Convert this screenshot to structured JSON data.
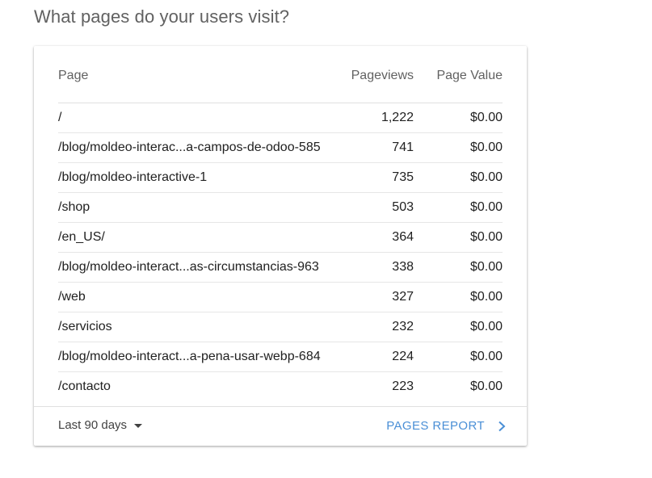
{
  "heading": "What pages do your users visit?",
  "table": {
    "headers": {
      "page": "Page",
      "pageviews": "Pageviews",
      "page_value": "Page Value"
    },
    "rows": [
      {
        "page": "/",
        "pageviews": "1,222",
        "value": "$0.00"
      },
      {
        "page": "/blog/moldeo-interac...a-campos-de-odoo-585",
        "pageviews": "741",
        "value": "$0.00"
      },
      {
        "page": "/blog/moldeo-interactive-1",
        "pageviews": "735",
        "value": "$0.00"
      },
      {
        "page": "/shop",
        "pageviews": "503",
        "value": "$0.00"
      },
      {
        "page": "/en_US/",
        "pageviews": "364",
        "value": "$0.00"
      },
      {
        "page": "/blog/moldeo-interact...as-circumstancias-963",
        "pageviews": "338",
        "value": "$0.00"
      },
      {
        "page": "/web",
        "pageviews": "327",
        "value": "$0.00"
      },
      {
        "page": "/servicios",
        "pageviews": "232",
        "value": "$0.00"
      },
      {
        "page": "/blog/moldeo-interact...a-pena-usar-webp-684",
        "pageviews": "224",
        "value": "$0.00"
      },
      {
        "page": "/contacto",
        "pageviews": "223",
        "value": "$0.00"
      }
    ]
  },
  "footer": {
    "date_range": "Last 90 days",
    "report_link": "PAGES REPORT",
    "caret_icon": "caret-down-icon",
    "chevron_icon": "chevron-right-icon",
    "link_color": "#4a8fd6"
  }
}
